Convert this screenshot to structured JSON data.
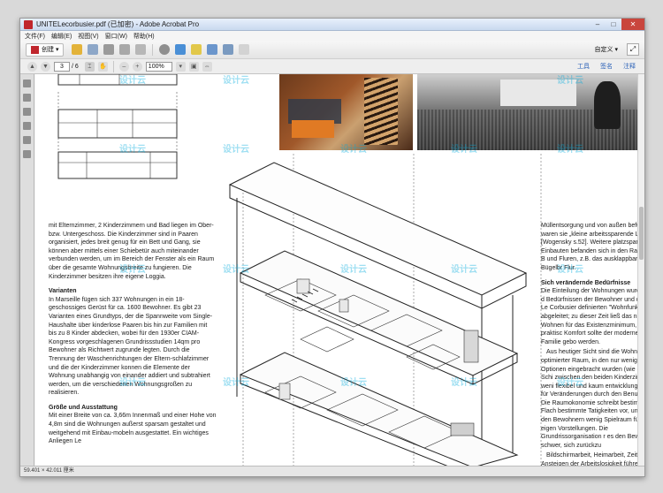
{
  "window": {
    "title": "UNITELecorbusier.pdf (已加密) - Adobe Acrobat Pro",
    "controls": {
      "minimize": "–",
      "maximize": "□",
      "close": "✕"
    }
  },
  "menu": [
    "文件(F)",
    "编辑(E)",
    "视图(V)",
    "窗口(W)",
    "帮助(H)"
  ],
  "toolbar": {
    "create_label": "创建 ▾",
    "customize_label": "自定义 ▾",
    "page_current": "3",
    "page_total": "/ 6",
    "zoom": "100%",
    "right_links": [
      "工具",
      "签名",
      "注释"
    ]
  },
  "status": {
    "size": "59.401 × 42.011 厘米"
  },
  "watermark": "设计云",
  "document": {
    "left_intro": "mit Elternzimmer, 2 Kinderzimmern und Bad liegen im Ober- bzw. Untergeschoss. Die Kinderzimmer sind in Paaren organisiert, jedes breit genug für ein Bett und Gang, sie können aber mittels einer Schiebetür auch miteinander verbunden werden, um im Bereich der Fenster als ein Raum über die gesamte Wohnungsbreite zu fungieren. Die Kinderzimmer besitzen ihre eigene Loggia.",
    "left_heading_1": "Varianten",
    "left_text_1": "In Marseille fügen sich 337 Wohnungen in ein 18-geschossiges Gerüst für ca. 1600 Bewohner. Es gibt 23 Varianten eines Grundtyps, der die Spannweite vom Single-Haushalte über kinderlose Paaren bis hin zur Familien mit bis zu 8 Kinder abdecken, wobei für den 1930er CIAM-Kongress vorgeschlagenen Grundrissstudien 14qm pro Bewohner als Richtwert zugrunde legten. Durch die Trennung der Waschenrichtungen der Eltern-schlafzimmer und die der Kinderzimmer konnen die Elemente der Wohnung unabhangig von einander addiert und subtrahiert werden, um die verschiedenen Wohnungsgroßen zu realisieren.",
    "left_heading_2": "Größe und Ausstattung",
    "left_text_2": "Mit einer Breite von ca. 3,66m Innenmaß und einer Hohe von 4,8m sind die Wohnungen außerst sparsam gestaltet und weitgehend mit Einbau-mobeln ausgestattet. Ein wichtiges Anliegen Le",
    "right_intro": "Müllentsorgung und von außen befüllbaren waren sie „kleine arbeitssparende Labore“ [Wogensky s.52]. Weitere platzsparende Einbauten befanden sich in den Raumen, B und Fluren, z.B. das ausklappbare Bügelbr Flur.",
    "right_heading": "Sich verändernde Bedürfnisse",
    "right_text_1": "Die Einteilung der Wohnungen wurde von d Bedürfnissen der Bewohner und den von Le Corbusier definierten \"Wohnfunktionen\" abgeleitet; zu dieser Zeit ließ das nicht me Wohnen für das Existenzminimum, praktisc Komfort sollte der modernen Familie gebo werden.",
    "right_text_2": "Aus heutiger Sicht sind die Wohnungen, optimierter Raum, in den nur wenige verän Optionen eingebracht wurden (wie der Schi zwischen den beiden Kinderzimmern) weni flexibel und kaum entwicklungsfähig für Veränderungen durch den Benutzer. Die Raumokonomie schreibt bestimmten Flach bestimmte Tatigkeiten vor, und lasst den Bewohnern wenig Spielraum für ihre eigen Vorstellungen. Die Grundrissorganisation r es den Bewohnern schwer, sich zurückzu",
    "right_text_3": "Bildschirmarbeit, Heimarbeit, Zeitarbeit Ansteigen der Arbeitslosigkeit führen heute neuem Nutzungsansprüchen an die Wohnun offener Grundriss führt zu Konflikten"
  }
}
